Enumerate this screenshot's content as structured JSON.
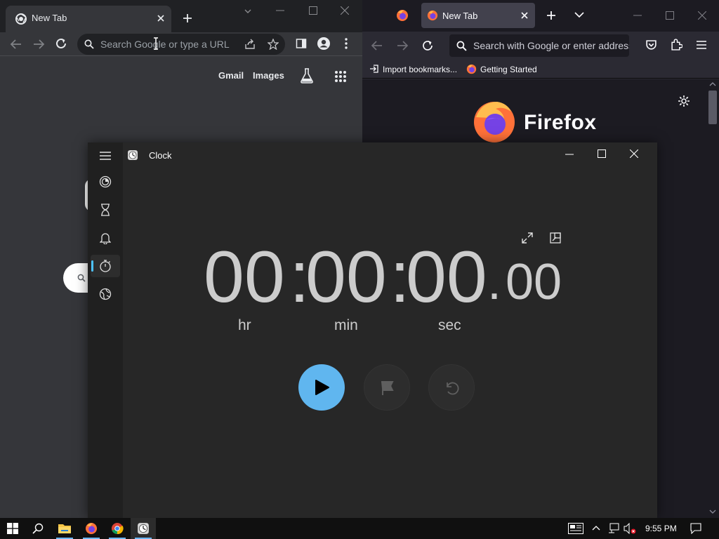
{
  "chrome": {
    "tab_title": "New Tab",
    "omnibox_placeholder": "Search Google or type a URL",
    "links": {
      "gmail": "Gmail",
      "images": "Images"
    }
  },
  "firefox": {
    "tab_title": "New Tab",
    "url_placeholder": "Search with Google or enter address",
    "bookmarks": [
      "Import bookmarks...",
      "Getting Started"
    ],
    "brand": "Firefox"
  },
  "clock": {
    "title": "Clock",
    "nav": [
      "focus-sessions-icon",
      "timer-icon",
      "alarm-icon",
      "stopwatch-icon",
      "world-clock-icon"
    ],
    "selected_nav": "stopwatch-icon",
    "hours": "00",
    "minutes": "00",
    "seconds": "00",
    "hundredths": "00",
    "labels": {
      "hr": "hr",
      "min": "min",
      "sec": "sec"
    },
    "accent": "#60b6ef"
  },
  "taskbar": {
    "time": "9:55 PM",
    "apps": [
      "start-icon",
      "search-icon",
      "file-explorer-icon",
      "firefox-icon",
      "chrome-icon",
      "clock-icon"
    ],
    "active_app": "clock-icon"
  }
}
